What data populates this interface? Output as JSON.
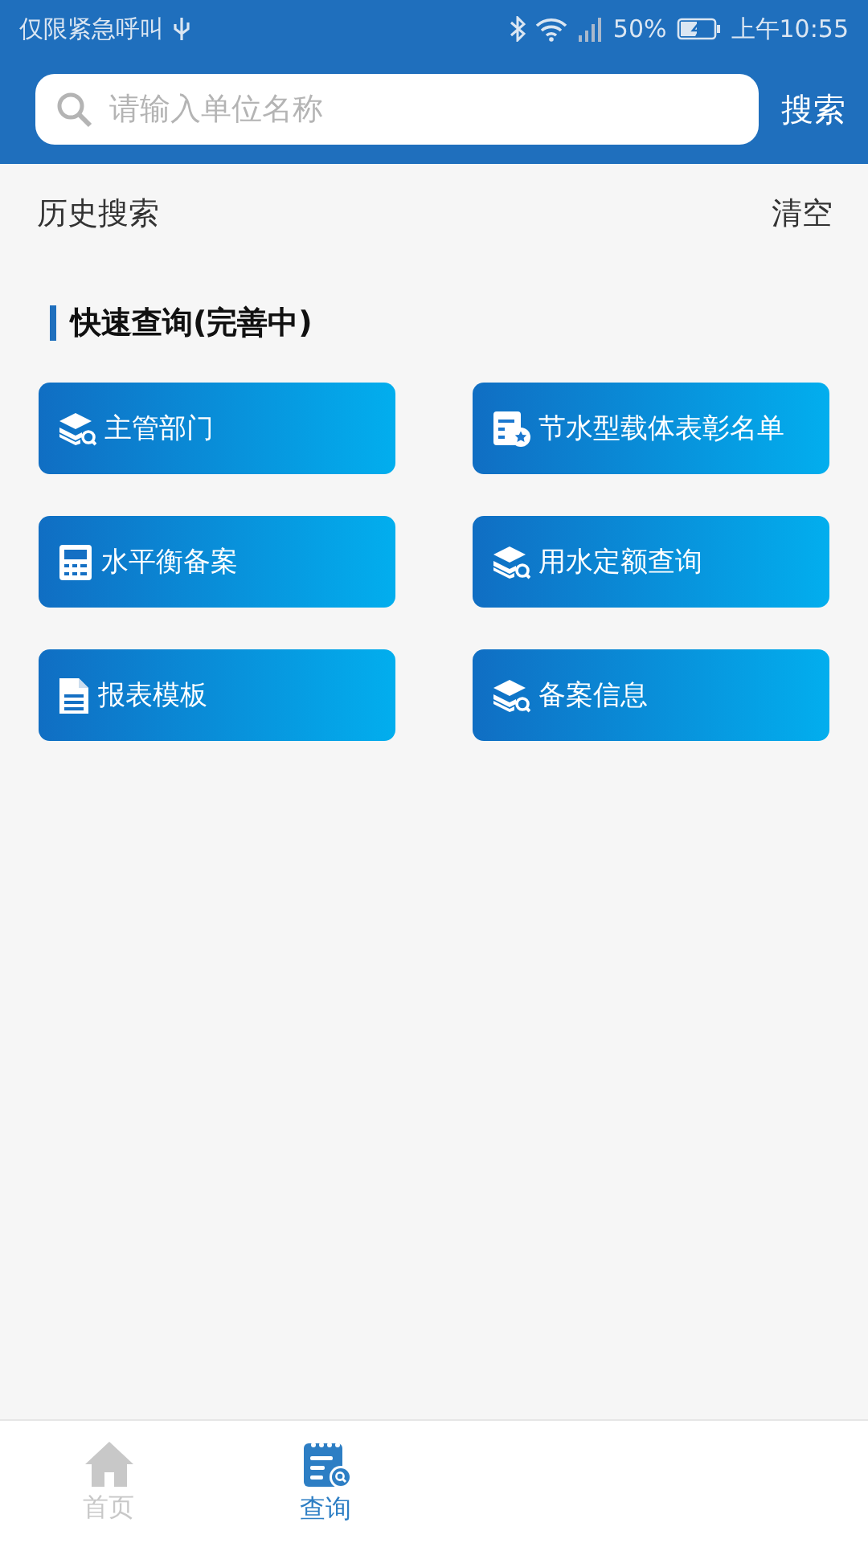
{
  "status_bar": {
    "carrier": "仅限紧急呼叫",
    "battery": "50%",
    "time": "上午10:55"
  },
  "search": {
    "placeholder": "请输入单位名称",
    "button": "搜索"
  },
  "history": {
    "title": "历史搜索",
    "clear": "清空"
  },
  "quick_query": {
    "title": "快速查询(完善中)",
    "items": [
      {
        "label": "主管部门",
        "kind": "stack"
      },
      {
        "label": "节水型载体表彰名单",
        "kind": "award"
      },
      {
        "label": "水平衡备案",
        "kind": "calculator"
      },
      {
        "label": "用水定额查询",
        "kind": "stack"
      },
      {
        "label": "报表模板",
        "kind": "document"
      },
      {
        "label": "备案信息",
        "kind": "stack"
      }
    ]
  },
  "tab_bar": [
    {
      "label": "首页",
      "kind": "home",
      "selected": false
    },
    {
      "label": "查询",
      "kind": "query",
      "selected": true
    }
  ]
}
